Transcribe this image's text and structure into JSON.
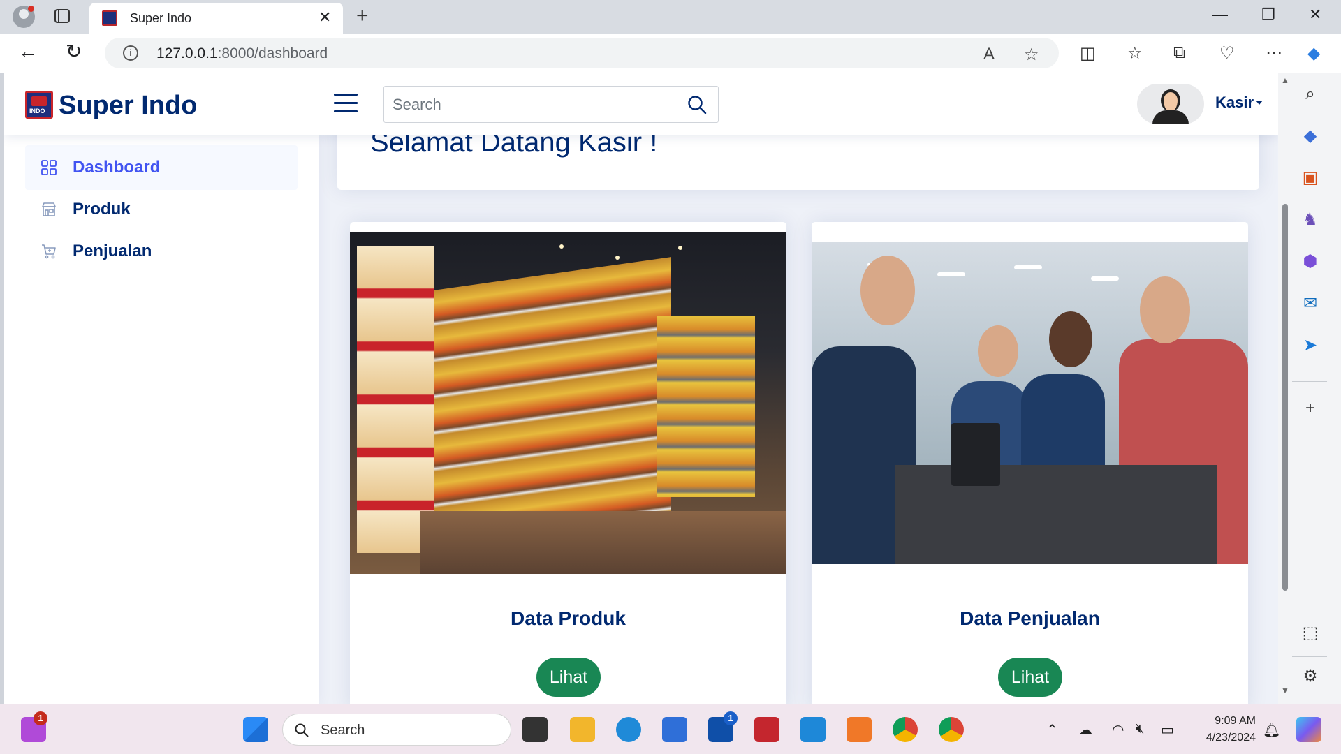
{
  "browser": {
    "tab_title": "Super Indo",
    "url_host": "127.0.0.1",
    "url_path": ":8000/dashboard"
  },
  "app": {
    "brand": "Super Indo",
    "search_placeholder": "Search",
    "user_name": "Kasir"
  },
  "sidebar": {
    "items": [
      {
        "label": "Dashboard",
        "icon": "grid-icon",
        "active": true
      },
      {
        "label": "Produk",
        "icon": "shop-icon",
        "active": false
      },
      {
        "label": "Penjualan",
        "icon": "cart-icon",
        "active": false
      }
    ]
  },
  "main": {
    "welcome": "Selamat Datang Kasir !",
    "cards": [
      {
        "title": "Data Produk",
        "button": "Lihat",
        "image": "supermarket-aisle"
      },
      {
        "title": "Data Penjualan",
        "button": "Lihat",
        "image": "checkout-counter"
      }
    ]
  },
  "taskbar": {
    "search_label": "Search",
    "time": "9:09 AM",
    "date": "4/23/2024",
    "badges": {
      "chat": "1",
      "l_app": "1"
    }
  },
  "colors": {
    "primary": "#012970",
    "accent": "#4154f1",
    "success": "#198754",
    "background": "#eef1f8"
  }
}
